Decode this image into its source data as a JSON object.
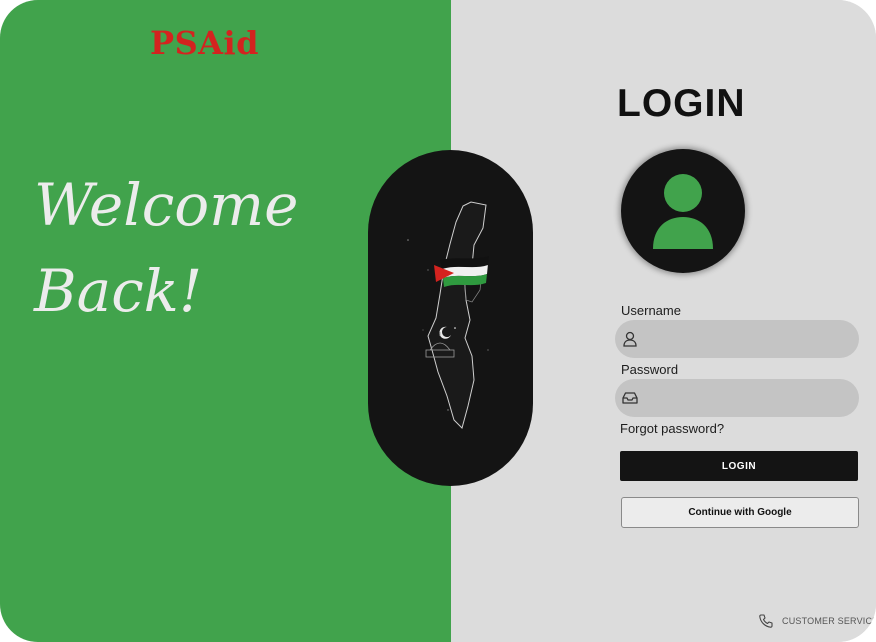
{
  "brand": {
    "name": "PSAid"
  },
  "welcome": {
    "line1": "Welcome",
    "line2": "Back!"
  },
  "login": {
    "title": "LOGIN",
    "username_label": "Username",
    "username_value": "",
    "password_label": "Password",
    "password_value": "",
    "forgot_label": "Forgot password?",
    "login_button": "LOGIN",
    "google_button": "Continue with Google"
  },
  "footer": {
    "customer_service": "CUSTOMER SERVICE"
  },
  "colors": {
    "left_panel": "#41a34c",
    "right_panel": "#dcdcdc",
    "brand": "#d4231f",
    "dark": "#141414",
    "field": "#c4c4c4"
  },
  "icons": [
    "user-icon",
    "inbox-icon",
    "phone-icon",
    "avatar-icon",
    "palestine-map",
    "palestine-flag"
  ]
}
